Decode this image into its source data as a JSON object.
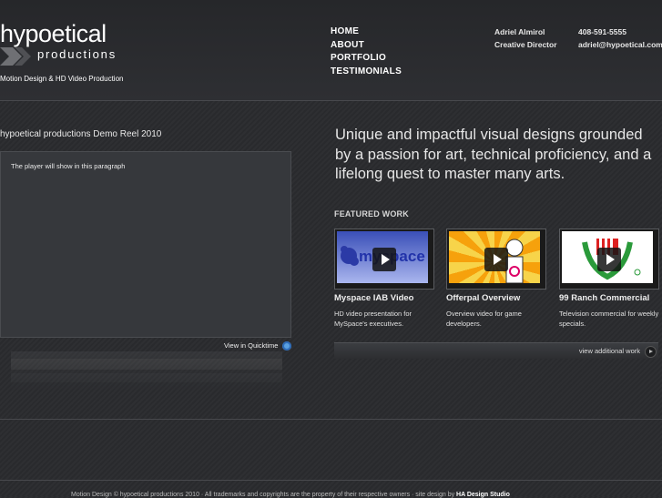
{
  "logo": {
    "main": "hypoetical",
    "sub": "productions"
  },
  "tagline": "Motion Design & HD Video Production",
  "nav": [
    "HOME",
    "ABOUT",
    "PORTFOLIO",
    "TESTIMONIALS"
  ],
  "contact": {
    "name": "Adriel Almirol",
    "role": "Creative Director",
    "phone": "408-591-5555",
    "email": "adriel@hypoetical.com"
  },
  "reel": {
    "title": "hypoetical productions Demo Reel 2010",
    "player_text": "The player will show in this paragraph",
    "quicktime": "View in Quicktime"
  },
  "intro": "Unique and impactful visual designs grounded by a passion for art, technical proficiency, and a lifelong quest to master many arts.",
  "featured": {
    "heading": "FEATURED WORK",
    "items": [
      {
        "title": "Myspace IAB Video",
        "desc": "HD video presentation for MySpace's executives.",
        "thumb_text": "myspace"
      },
      {
        "title": "Offerpal Overview",
        "desc": "Overview video for game developers."
      },
      {
        "title": "99 Ranch Commercial",
        "desc": "Television commercial for weekly specials."
      }
    ],
    "more": "view additional work"
  },
  "footer": {
    "text": "Motion Design © hypoetical productions 2010 · All trademarks and copyrights are the property of their respective owners · site design by",
    "credit": "HA Design Studio"
  },
  "colors": {
    "background": "#2a2b2e",
    "divider": "#48494d",
    "link_blue": "#5aa0e0"
  },
  "icons": [
    "logo-chevron-icon",
    "play-icon",
    "quicktime-icon",
    "arrow-right-icon"
  ]
}
